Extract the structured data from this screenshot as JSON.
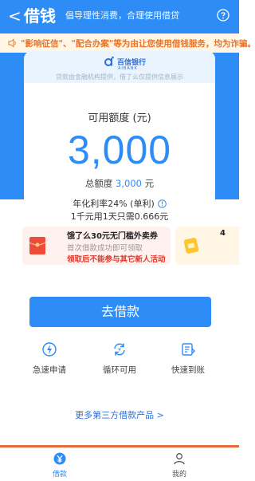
{
  "navbar": {
    "back_glyph": "<",
    "title": "借钱",
    "subtitle": "倡导理性消费，合理使用借贷",
    "help_icon": "help-icon"
  },
  "notice": {
    "text": "\"影响征信\"、\"配合办案\"等为由让您使用借钱服务，均为诈骗。"
  },
  "card": {
    "bank_name": "百信银行",
    "bank_en": "AIBANK",
    "head_note": "贷款由金融机构提供，借了么仅提供信息展示"
  },
  "credit": {
    "available_label": "可用额度 (元)",
    "amount": "3,000",
    "total_prefix": "总额度",
    "total_value": "3,000",
    "total_unit": "元",
    "rate_text": "年化利率24% (单利)",
    "daily_text": "1千元用1天只需0.666元"
  },
  "promo": {
    "title": "饿了么30元无门槛外卖券",
    "subtitle": "首次借款成功即可领取",
    "note": "领取后不能参与其它新人活动",
    "next_title": "4"
  },
  "actions": {
    "borrow_label": "去借款",
    "more_label": "更多第三方借款产品 >"
  },
  "features": [
    {
      "label": "急速申请",
      "icon": "lightning-icon"
    },
    {
      "label": "循环可用",
      "icon": "cycle-icon"
    },
    {
      "label": "快速到账",
      "icon": "fast-transfer-icon"
    }
  ],
  "tabs": [
    {
      "label": "借款",
      "icon": "yuan-icon",
      "active": true
    },
    {
      "label": "我的",
      "icon": "user-icon",
      "active": false
    }
  ],
  "colors": {
    "primary": "#2d8cf6",
    "notice_text": "#e7752a",
    "warning_red": "#e0392d"
  }
}
